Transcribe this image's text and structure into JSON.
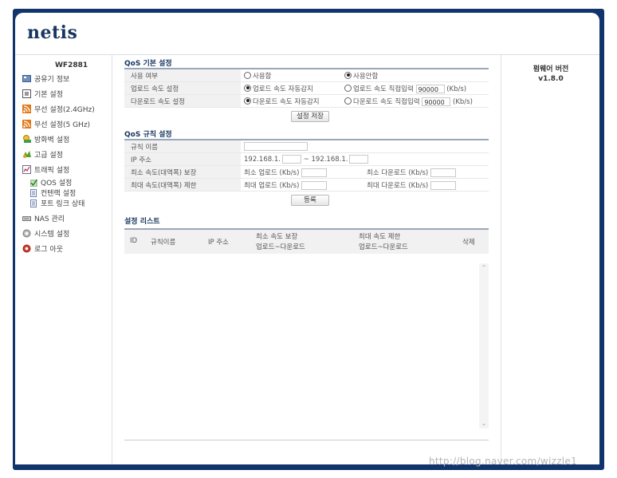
{
  "brand": "netis",
  "model": "WF2881",
  "nav": {
    "items": [
      {
        "label": "공유기 정보",
        "icon": "info-icon"
      },
      {
        "label": "기본 설정",
        "icon": "basic-settings-icon"
      },
      {
        "label": "무선 설정(2.4GHz)",
        "icon": "wireless-icon"
      },
      {
        "label": "무선 설정(5 GHz)",
        "icon": "wireless-icon"
      },
      {
        "label": "방화벽 설정",
        "icon": "firewall-icon"
      },
      {
        "label": "고급 설정",
        "icon": "advanced-icon"
      },
      {
        "label": "트래픽 설정",
        "icon": "traffic-icon"
      }
    ],
    "sub_items": [
      {
        "label": "QOS 설정",
        "icon": "check-icon"
      },
      {
        "label": "컨텐랙 설정",
        "icon": "document-icon"
      },
      {
        "label": "포트 링크 상태",
        "icon": "document-icon"
      }
    ],
    "items2": [
      {
        "label": "NAS 관리",
        "icon": "nas-icon"
      },
      {
        "label": "시스템 설정",
        "icon": "system-icon"
      },
      {
        "label": "로그 아웃",
        "icon": "logout-icon"
      }
    ]
  },
  "firmware": {
    "title": "펌웨어 버전",
    "version": "v1.8.0"
  },
  "qos_basic": {
    "title": "QoS 기본 설정",
    "enable_label": "사용 여부",
    "enable_on": "사용함",
    "enable_off": "사용안함",
    "upload_label": "업로드 속도 설정",
    "upload_auto": "업로드 속도 자동감지",
    "upload_manual": "업로드 속도 직접입력",
    "upload_value": "90000",
    "download_label": "다운로드 속도 설정",
    "download_auto": "다운로드 속도 자동감지",
    "download_manual": "다운로드 속도 직접입력",
    "download_value": "90000",
    "unit": "(Kb/s)",
    "save_button": "설정 저장"
  },
  "qos_rule": {
    "title": "QoS 규칙 설정",
    "rule_name_label": "규칙 이름",
    "ip_label": "IP 주소",
    "ip_prefix_start": "192.168.1.",
    "ip_separator": "~",
    "ip_prefix_end": "192.168.1.",
    "min_label": "최소 속도(대역폭) 보장",
    "min_upload": "최소 업로드 (Kb/s)",
    "min_download": "최소 다운로드 (Kb/s)",
    "max_label": "최대 속도(대역폭) 제한",
    "max_upload": "최대 업로드 (Kb/s)",
    "max_download": "최대 다운로드 (Kb/s)",
    "register_button": "등록"
  },
  "rule_list": {
    "title": "설정 리스트",
    "col_id": "ID",
    "col_name": "규칙이름",
    "col_ip": "IP 주소",
    "col_min_top": "최소 속도 보장",
    "col_min_bottom": "업로드~다운로드",
    "col_max_top": "최대 속도 제한",
    "col_max_bottom": "업로드~다운로드",
    "col_delete": "삭제"
  },
  "watermark": "http://blog.naver.com/wizzle1"
}
